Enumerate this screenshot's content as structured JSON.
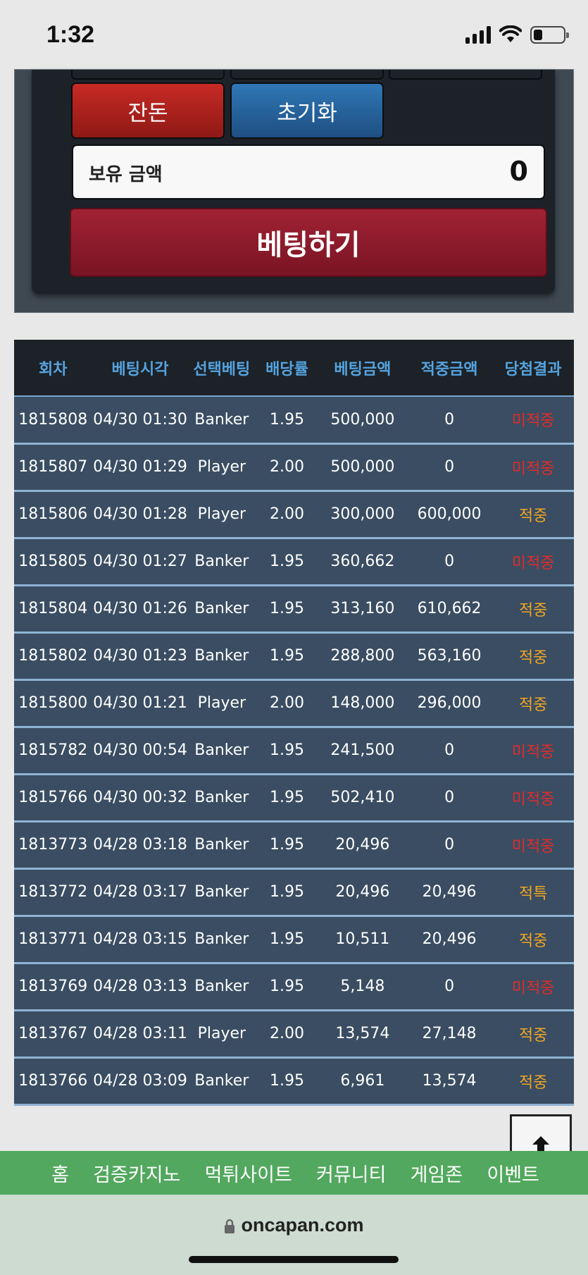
{
  "status_bar": {
    "time": "1:32"
  },
  "panel": {
    "change_button": "잔돈",
    "reset_button": "초기화",
    "balance_label": "보유 금액",
    "balance_value": "0",
    "bet_button": "베팅하기"
  },
  "table": {
    "headers": [
      "회차",
      "베팅시각",
      "선택베팅",
      "배당률",
      "베팅금액",
      "적중금액",
      "당첨결과"
    ],
    "rows": [
      [
        "1815808",
        "04/30 01:30",
        "Banker",
        "1.95",
        "500,000",
        "0",
        "미적중"
      ],
      [
        "1815807",
        "04/30 01:29",
        "Player",
        "2.00",
        "500,000",
        "0",
        "미적중"
      ],
      [
        "1815806",
        "04/30 01:28",
        "Player",
        "2.00",
        "300,000",
        "600,000",
        "적중"
      ],
      [
        "1815805",
        "04/30 01:27",
        "Banker",
        "1.95",
        "360,662",
        "0",
        "미적중"
      ],
      [
        "1815804",
        "04/30 01:26",
        "Banker",
        "1.95",
        "313,160",
        "610,662",
        "적중"
      ],
      [
        "1815802",
        "04/30 01:23",
        "Banker",
        "1.95",
        "288,800",
        "563,160",
        "적중"
      ],
      [
        "1815800",
        "04/30 01:21",
        "Player",
        "2.00",
        "148,000",
        "296,000",
        "적중"
      ],
      [
        "1815782",
        "04/30 00:54",
        "Banker",
        "1.95",
        "241,500",
        "0",
        "미적중"
      ],
      [
        "1815766",
        "04/30 00:32",
        "Banker",
        "1.95",
        "502,410",
        "0",
        "미적중"
      ],
      [
        "1813773",
        "04/28 03:18",
        "Banker",
        "1.95",
        "20,496",
        "0",
        "미적중"
      ],
      [
        "1813772",
        "04/28 03:17",
        "Banker",
        "1.95",
        "20,496",
        "20,496",
        "적특"
      ],
      [
        "1813771",
        "04/28 03:15",
        "Banker",
        "1.95",
        "10,511",
        "20,496",
        "적중"
      ],
      [
        "1813769",
        "04/28 03:13",
        "Banker",
        "1.95",
        "5,148",
        "0",
        "미적중"
      ],
      [
        "1813767",
        "04/28 03:11",
        "Player",
        "2.00",
        "13,574",
        "27,148",
        "적중"
      ],
      [
        "1813766",
        "04/28 03:09",
        "Banker",
        "1.95",
        "6,961",
        "13,574",
        "적중"
      ]
    ]
  },
  "colors": {
    "miss": "#e02b2b",
    "hit": "#f0a524",
    "header_text": "#55a3e0"
  },
  "scroll_top": {
    "icon": "arrow-up-icon"
  },
  "bottom_nav": [
    "홈",
    "검증카지노",
    "먹튀사이트",
    "커뮤니티",
    "게임존",
    "이벤트"
  ],
  "browser": {
    "url": "oncapan.com",
    "icon": "lock-icon"
  }
}
